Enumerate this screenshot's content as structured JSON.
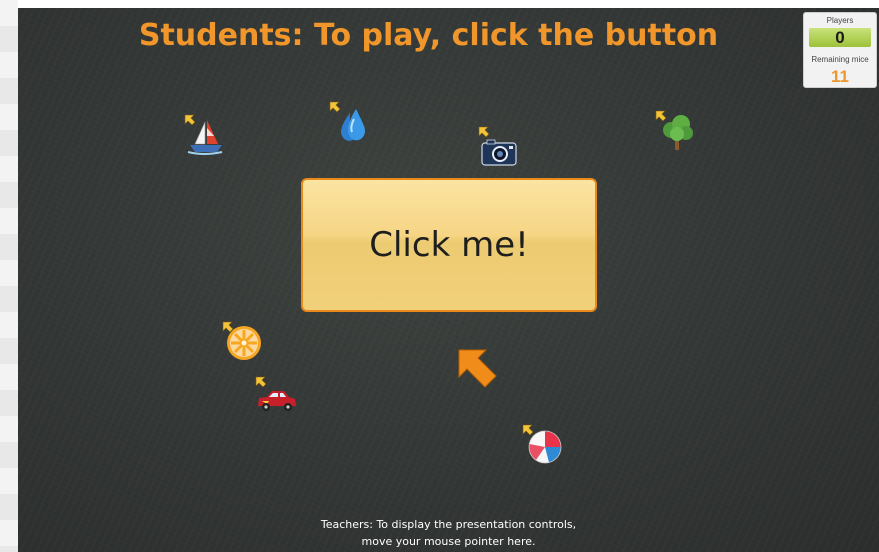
{
  "title": "Students: To play, click the button",
  "counters": {
    "players_label": "Players",
    "players_value": "0",
    "mice_label": "Remaining mice",
    "mice_value": "11"
  },
  "button": {
    "label": "Click me!"
  },
  "footer": {
    "line1": "Teachers: To display the presentation controls,",
    "line2": "move your mouse pointer here."
  },
  "colors": {
    "accent": "#f0962a",
    "board": "#353937",
    "button_border": "#e98a1b",
    "players_box": "#9cc23a"
  },
  "mice": [
    {
      "icon": "sailboat-icon"
    },
    {
      "icon": "water-drop-icon"
    },
    {
      "icon": "camera-icon"
    },
    {
      "icon": "tree-icon"
    },
    {
      "icon": "orange-slice-icon"
    },
    {
      "icon": "car-icon"
    },
    {
      "icon": "beach-ball-icon"
    },
    {
      "icon": "large-pointer-icon"
    }
  ]
}
